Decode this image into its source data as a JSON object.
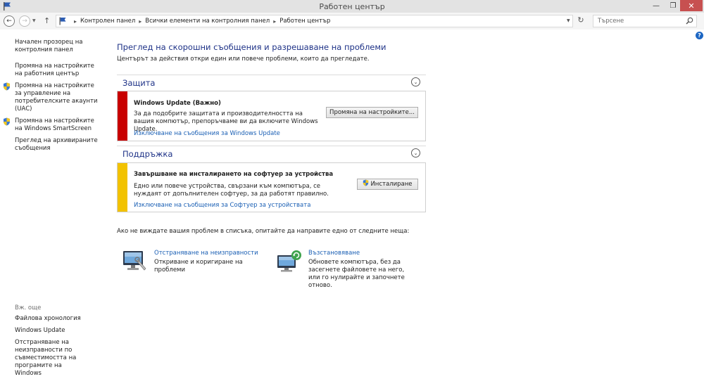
{
  "window": {
    "title": "Работен център"
  },
  "address": {
    "crumbs": [
      "Контролен панел",
      "Всички елементи на контролния панел",
      "Работен център"
    ],
    "search_placeholder": "Търсене"
  },
  "sidebar": {
    "items": [
      {
        "label": "Начален прозорец на контролния панел",
        "shield": false
      },
      {
        "label": "Промяна на настройките на работния център",
        "shield": false
      },
      {
        "label": "Промяна на настройките за управление на потребителските акаунти (UAC)",
        "shield": true
      },
      {
        "label": "Промяна на настройките на Windows SmartScreen",
        "shield": true
      },
      {
        "label": "Преглед на архивираните съобщения",
        "shield": false
      }
    ],
    "see_also": {
      "header": "Вж. още",
      "items": [
        "Файлова хронология",
        "Windows Update",
        "Отстраняване на неизправности по съвместимостта на програмите на Windows"
      ]
    }
  },
  "main": {
    "title": "Преглед на скорошни съобщения и разрешаване на проблеми",
    "description": "Центърът за действия откри един или повече проблеми, които да прегледате.",
    "security": {
      "header": "Защита",
      "message": {
        "title": "Windows Update  (Важно)",
        "text": "За да подобрите защитата и производителността на вашия компютър, препоръчваме ви да включите Windows Update.",
        "link": "Изключване на съобщения за Windows Update",
        "button": "Промяна на настройките..."
      }
    },
    "maintenance": {
      "header": "Поддръжка",
      "message": {
        "title": "Завършване на инсталирането на софтуер за устройства",
        "text": "Едно или повече устройства, свързани към компютъра, се нуждаят от допълнителен софтуер, за да работят правилно.",
        "link": "Изключване на съобщения за Софтуер за устройствата",
        "button": "Инсталиране"
      }
    },
    "hint": "Ако не виждате вашия проблем в списъка, опитайте да направите едно от следните неща:",
    "tools": [
      {
        "title": "Отстраняване на неизправности",
        "desc": "Откриване и коригиране на проблеми"
      },
      {
        "title": "Възстановяване",
        "desc": "Обновете компютъра, без да засегнете файловете на него, или го нулирайте и започнете отново."
      }
    ]
  },
  "colors": {
    "security_stripe": "#c80000",
    "maintenance_stripe": "#f2c200",
    "link": "#1a5fb4",
    "heading": "#1e3287"
  }
}
